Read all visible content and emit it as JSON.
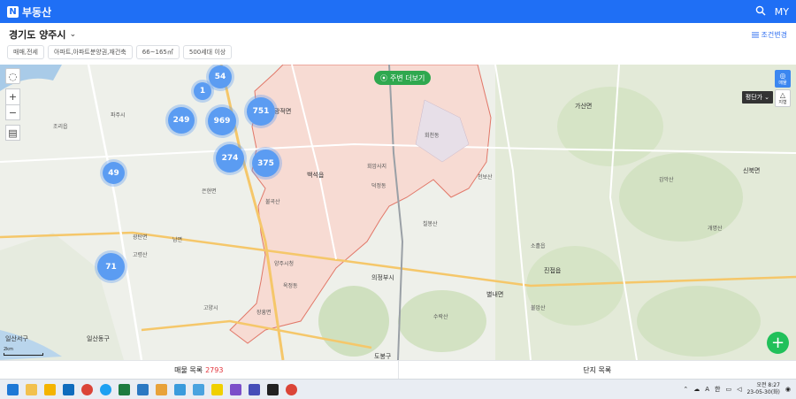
{
  "header": {
    "logo_letter": "N",
    "brand": "부동산",
    "user": "MY"
  },
  "region": {
    "title": "경기도 양주시",
    "condition_link": "조건변경"
  },
  "filters": [
    "매매,전세",
    "아파트,아파트분양권,재건축",
    "66~165㎡",
    "500세대 이상"
  ],
  "map": {
    "nearby_button": "주변 더보기",
    "price_toggle": "평단가",
    "side_buttons": [
      "매물",
      "지형"
    ],
    "scale_label": "2km",
    "clusters": [
      {
        "value": "54"
      },
      {
        "value": "1"
      },
      {
        "value": "249"
      },
      {
        "value": "969"
      },
      {
        "value": "751"
      },
      {
        "value": "274"
      },
      {
        "value": "375"
      },
      {
        "value": "49"
      },
      {
        "value": "71"
      }
    ],
    "labels": [
      "광적면",
      "백석읍",
      "회천동",
      "은현면",
      "남면",
      "회암사지",
      "칠봉산",
      "불곡산",
      "양주시청",
      "의정부시",
      "덕정동",
      "옥정동",
      "장흥면",
      "일산서구",
      "일산동구",
      "가산면",
      "신북면",
      "소흘읍",
      "진접읍",
      "별내면",
      "도봉구",
      "수락산",
      "불암산",
      "천보산",
      "감악산",
      "개명산",
      "고양시",
      "파주시",
      "조리읍",
      "광탄면",
      "고령산"
    ]
  },
  "tabs": {
    "listings_label": "매물 목록",
    "listings_count": "2793",
    "complex_label": "단지 목록"
  },
  "taskbar": {
    "tray_lang": "A",
    "tray_ime": "한",
    "time": "오전 8:27",
    "date": "23-05-30(화)"
  },
  "colors": {
    "header": "#1f6ff5",
    "cluster": "#5b9cf2",
    "selected_region": "#f5b9ae",
    "nearby_green": "#2fa84f",
    "fab_green": "#21c05a"
  }
}
